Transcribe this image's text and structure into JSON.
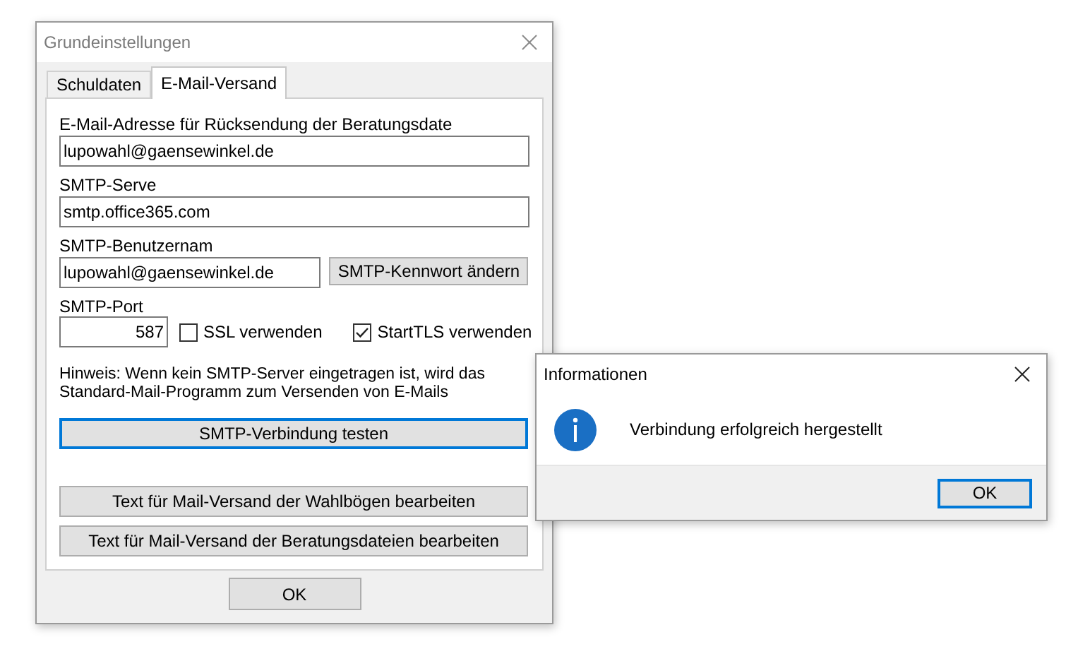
{
  "main_window": {
    "title": "Grundeinstellungen",
    "tabs": [
      {
        "label": "Schuldaten",
        "selected": false
      },
      {
        "label": "E-Mail-Versand",
        "selected": true
      }
    ],
    "return_address": {
      "label": "E-Mail-Adresse für Rücksendung der Beratungsdate",
      "value": "lupowahl@gaensewinkel.de"
    },
    "smtp_server": {
      "label": "SMTP-Serve",
      "value": "smtp.office365.com"
    },
    "smtp_user": {
      "label": "SMTP-Benutzernam",
      "value": "lupowahl@gaensewinkel.de"
    },
    "password_button": {
      "label": "SMTP-Kennwort ändern",
      "focused": false
    },
    "smtp_port": {
      "label": "SMTP-Port",
      "value": "587"
    },
    "checkboxes": [
      {
        "label": "SSL verwenden",
        "checked": false
      },
      {
        "label": "StartTLS verwenden",
        "checked": true
      }
    ],
    "hint_lines": [
      "Hinweis: Wenn kein SMTP-Server eingetragen ist, wird das",
      "Standard-Mail-Programm zum Versenden von E-Mails"
    ],
    "test_button": {
      "label": "SMTP-Verbindung testen",
      "focused": true
    },
    "text_buttons": [
      {
        "label": "Text für Mail-Versand der Wahlbögen bearbeiten",
        "focused": false
      },
      {
        "label": "Text für Mail-Versand der Beratungsdateien bearbeiten",
        "focused": false
      }
    ],
    "ok_button": {
      "label": "OK",
      "focused": false
    }
  },
  "info_dialog": {
    "title": "Informationen",
    "message": "Verbindung erfolgreich hergestellt",
    "ok_button": {
      "label": "OK",
      "focused": true
    }
  }
}
